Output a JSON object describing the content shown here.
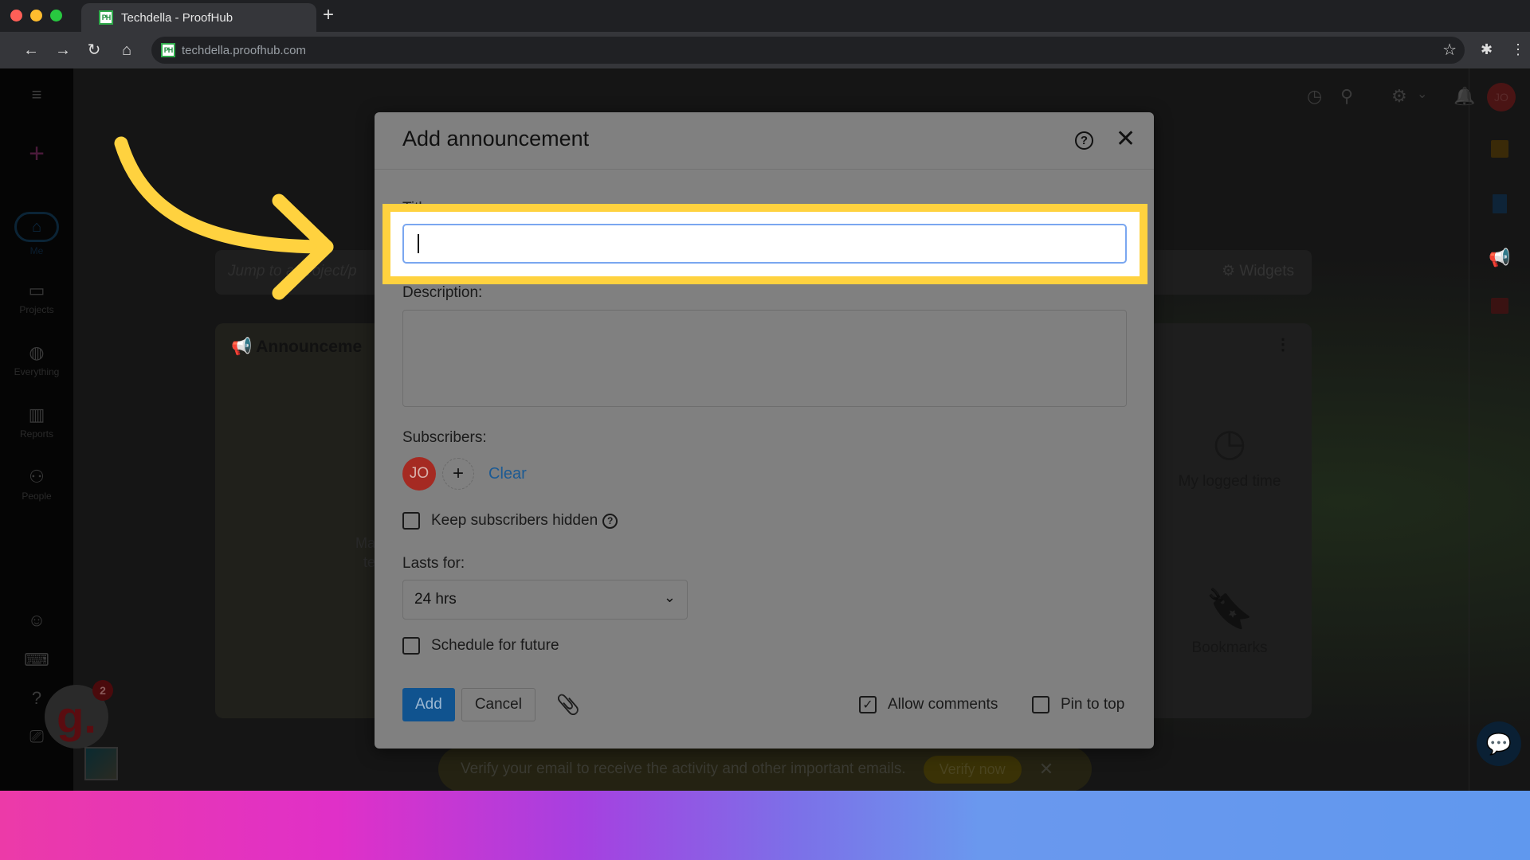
{
  "browser": {
    "tab_title": "Techdella - ProofHub",
    "favicon_text": "PH",
    "new_tab_symbol": "+",
    "url": "techdella.proofhub.com",
    "nav": {
      "back": "←",
      "forward": "→",
      "reload": "↻",
      "home": "⌂",
      "bookmark_star": "☆",
      "extensions": "✱",
      "menu": "⋮"
    }
  },
  "sidebar": {
    "menu_icon": "≡",
    "add_icon": "+",
    "items": [
      {
        "label": "Me",
        "icon": "⌂"
      },
      {
        "label": "Projects",
        "icon": "▭"
      },
      {
        "label": "Everything",
        "icon": "◍"
      },
      {
        "label": "Reports",
        "icon": "▥"
      },
      {
        "label": "People",
        "icon": "⚇"
      }
    ],
    "bottom_icons": [
      "☺",
      "⌨",
      "?",
      "⎚"
    ]
  },
  "topbar": {
    "timer_icon": "◷",
    "search_icon": "⚲",
    "settings_icon": "⚙",
    "chevron": "⌄",
    "bell_icon": "🔔",
    "user_initials": "JO"
  },
  "dashboard": {
    "jump_placeholder": "Jump to a project/p",
    "widgets_label": "Widgets",
    "widgets_icon": "⚙",
    "announcements_title": "Announceme",
    "announcements_faint_text": [
      "Ma",
      "te"
    ],
    "widgets": [
      {
        "label": "My logged time",
        "icon": "◷"
      },
      {
        "label": "Bookmarks",
        "icon": "🔖"
      }
    ],
    "kebab": "⋮"
  },
  "right_rail": {
    "icons": [
      "notes",
      "bookmark",
      "announcement",
      "calendar"
    ]
  },
  "verify_banner": {
    "text": "Verify your email to receive the activity and other important emails.",
    "button": "Verify now",
    "close": "✕"
  },
  "g2_widget": {
    "letter": "g.",
    "badge": "2"
  },
  "modal": {
    "title": "Add announcement",
    "help_symbol": "?",
    "close_symbol": "✕",
    "title_label": "Title:",
    "title_value": "",
    "description_label": "Description:",
    "description_value": "",
    "subscribers_label": "Subscribers:",
    "subscribers": [
      {
        "initials": "JO",
        "color": "#a52a22"
      }
    ],
    "add_subscriber_symbol": "+",
    "clear_label": "Clear",
    "keep_hidden_label": "Keep subscribers hidden",
    "keep_hidden_checked": false,
    "lasts_for_label": "Lasts for:",
    "lasts_for_value": "24 hrs",
    "schedule_label": "Schedule for future",
    "schedule_checked": false,
    "add_button": "Add",
    "cancel_button": "Cancel",
    "attach_symbol": "📎",
    "allow_comments_label": "Allow comments",
    "allow_comments_checked": true,
    "pin_to_top_label": "Pin to top",
    "pin_to_top_checked": false
  },
  "annotation": {
    "highlight_color": "#ffd23f",
    "target": "title-input"
  },
  "colors": {
    "accent_blue": "#10538f",
    "link_blue": "#1c5a93",
    "avatar_red": "#a52a22",
    "highlight_yellow": "#ffd23f"
  }
}
